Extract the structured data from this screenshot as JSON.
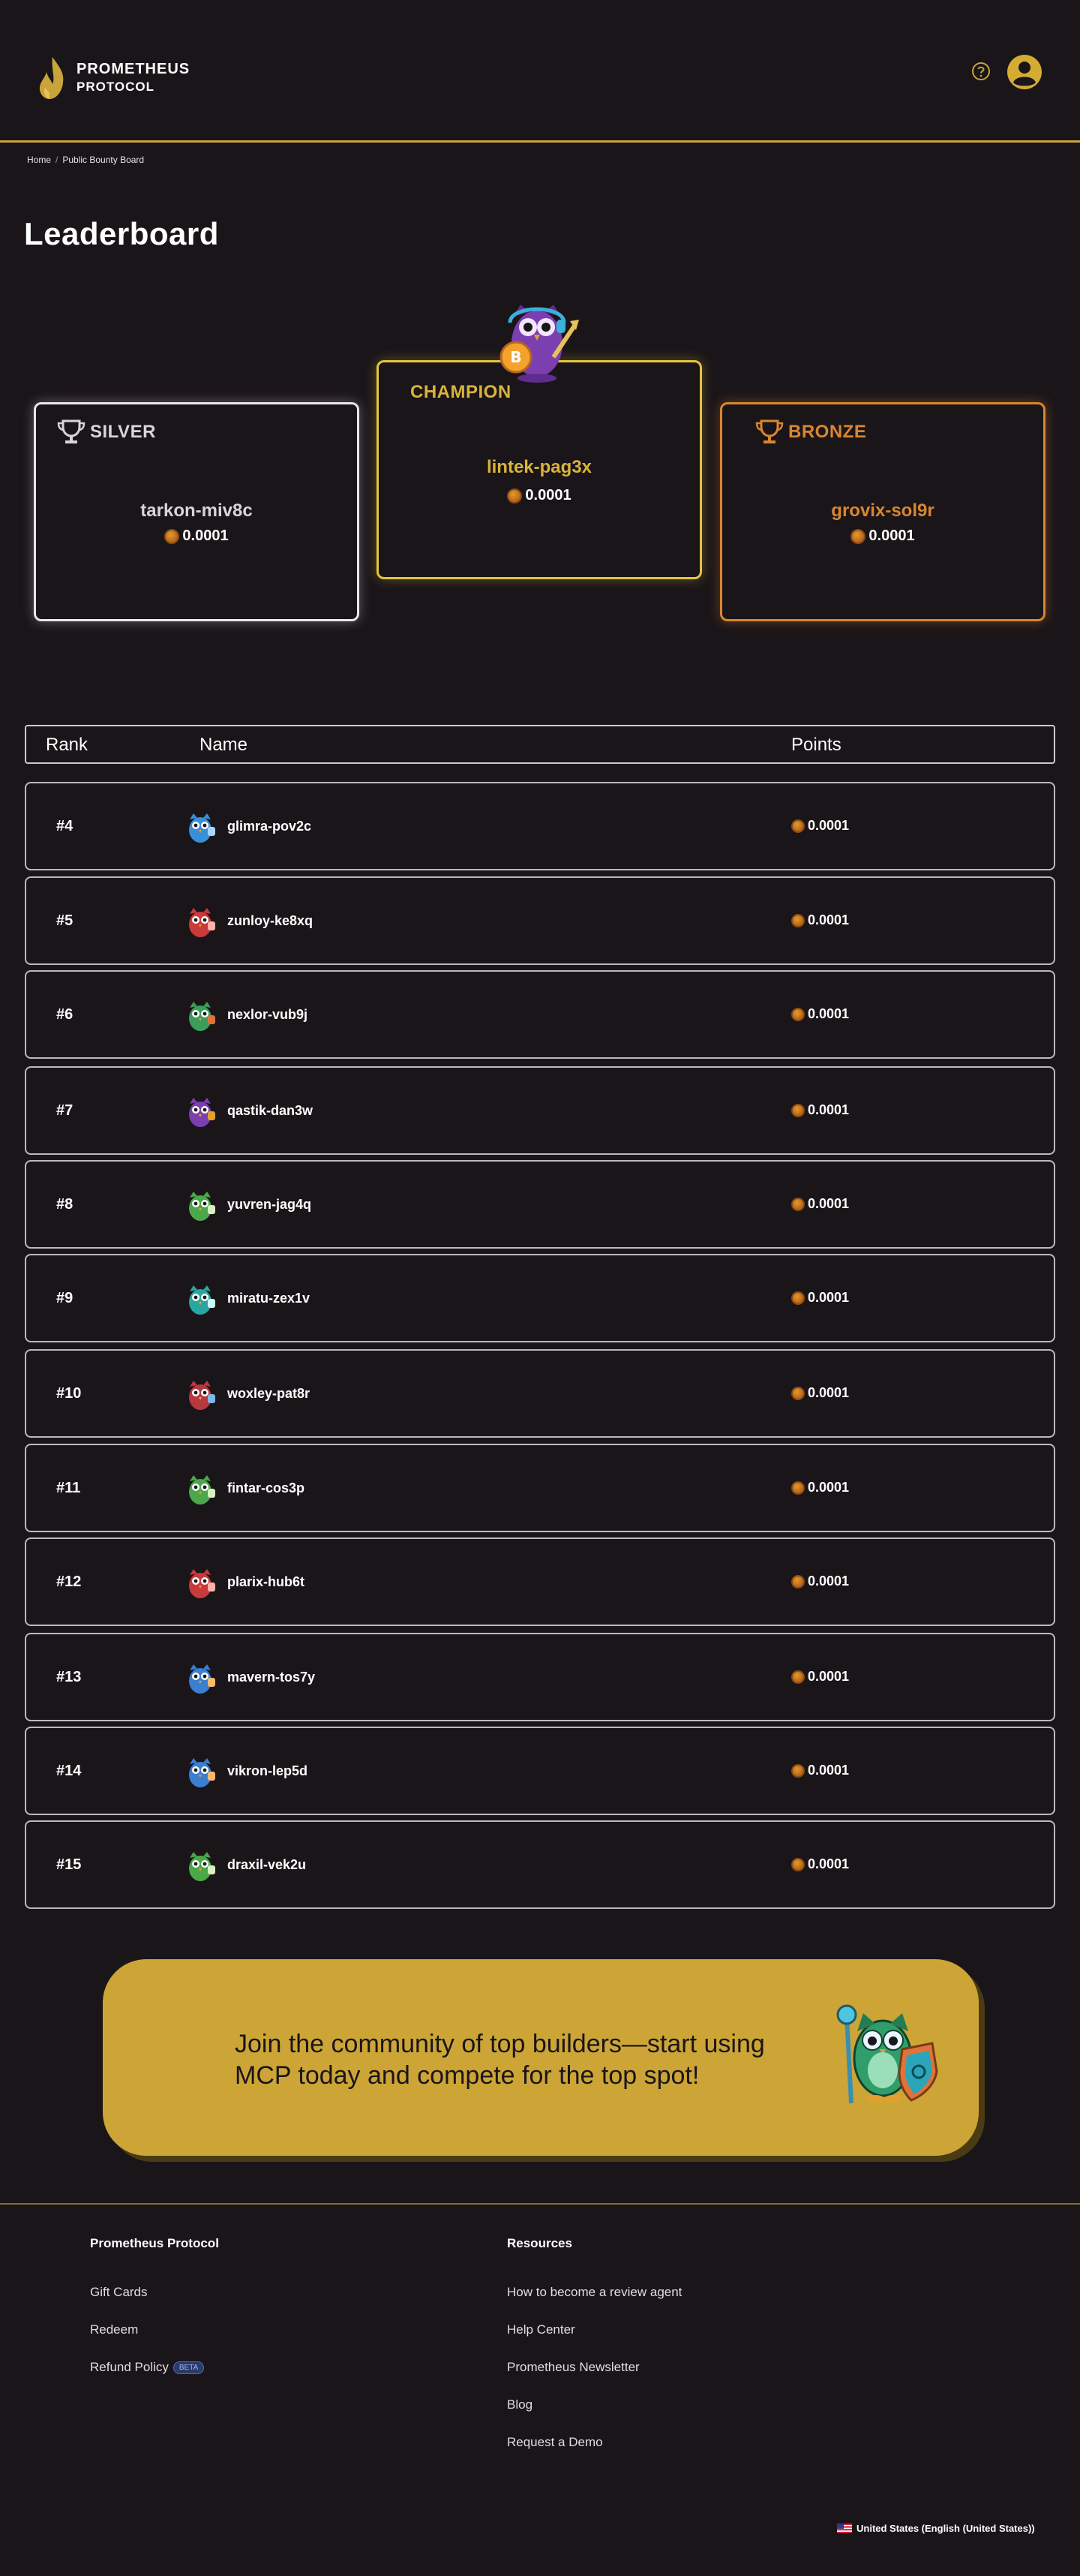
{
  "header": {
    "brand_line1": "PROMETHEUS",
    "brand_line2": "PROTOCOL",
    "accent_color": "#c9a43a"
  },
  "breadcrumb": {
    "home": "Home",
    "separator": "/",
    "current": "Public Bounty Board"
  },
  "page": {
    "title": "Leaderboard"
  },
  "podium": {
    "silver": {
      "tier": "SILVER",
      "name": "tarkon-miv8c",
      "points": "0.0001",
      "color": "#e9e6ea"
    },
    "champion": {
      "tier": "CHAMPION",
      "name": "lintek-pag3x",
      "points": "0.0001",
      "color": "#e6c33e"
    },
    "bronze": {
      "tier": "BRONZE",
      "name": "grovix-sol9r",
      "points": "0.0001",
      "color": "#d9862f"
    }
  },
  "table": {
    "headers": {
      "rank": "Rank",
      "name": "Name",
      "points": "Points"
    },
    "rows": [
      {
        "rank": "#4",
        "name": "glimra-pov2c",
        "points": "0.0001",
        "avatar": "blue-robot-owl-icon"
      },
      {
        "rank": "#5",
        "name": "zunloy-ke8xq",
        "points": "0.0001",
        "avatar": "red-owl-icon"
      },
      {
        "rank": "#6",
        "name": "nexlor-vub9j",
        "points": "0.0001",
        "avatar": "green-shield-owl-icon"
      },
      {
        "rank": "#7",
        "name": "qastik-dan3w",
        "points": "0.0001",
        "avatar": "purple-owl-icon"
      },
      {
        "rank": "#8",
        "name": "yuvren-jag4q",
        "points": "0.0001",
        "avatar": "green-owl-icon"
      },
      {
        "rank": "#9",
        "name": "miratu-zex1v",
        "points": "0.0001",
        "avatar": "teal-owl-icon"
      },
      {
        "rank": "#10",
        "name": "woxley-pat8r",
        "points": "0.0001",
        "avatar": "red-robot-owl-icon"
      },
      {
        "rank": "#11",
        "name": "fintar-cos3p",
        "points": "0.0001",
        "avatar": "green-owl-icon"
      },
      {
        "rank": "#12",
        "name": "plarix-hub6t",
        "points": "0.0001",
        "avatar": "red-owl-icon"
      },
      {
        "rank": "#13",
        "name": "mavern-tos7y",
        "points": "0.0001",
        "avatar": "blue-owl-icon"
      },
      {
        "rank": "#14",
        "name": "vikron-lep5d",
        "points": "0.0001",
        "avatar": "blue-owl-icon"
      },
      {
        "rank": "#15",
        "name": "draxil-vek2u",
        "points": "0.0001",
        "avatar": "green-owl-icon"
      }
    ]
  },
  "cta": {
    "text": "Join the community of top builders—start using MCP today and compete for the top spot!",
    "background": "#cca536"
  },
  "footer": {
    "col1": {
      "heading": "Prometheus Protocol",
      "links": [
        "Gift Cards",
        "Redeem",
        "Refund Policy"
      ],
      "beta_badge": "BETA"
    },
    "col2": {
      "heading": "Resources",
      "links": [
        "How to become a review agent",
        "Help Center",
        "Prometheus Newsletter",
        "Blog",
        "Request a Demo"
      ]
    },
    "locale": "United States (English (United States))"
  }
}
